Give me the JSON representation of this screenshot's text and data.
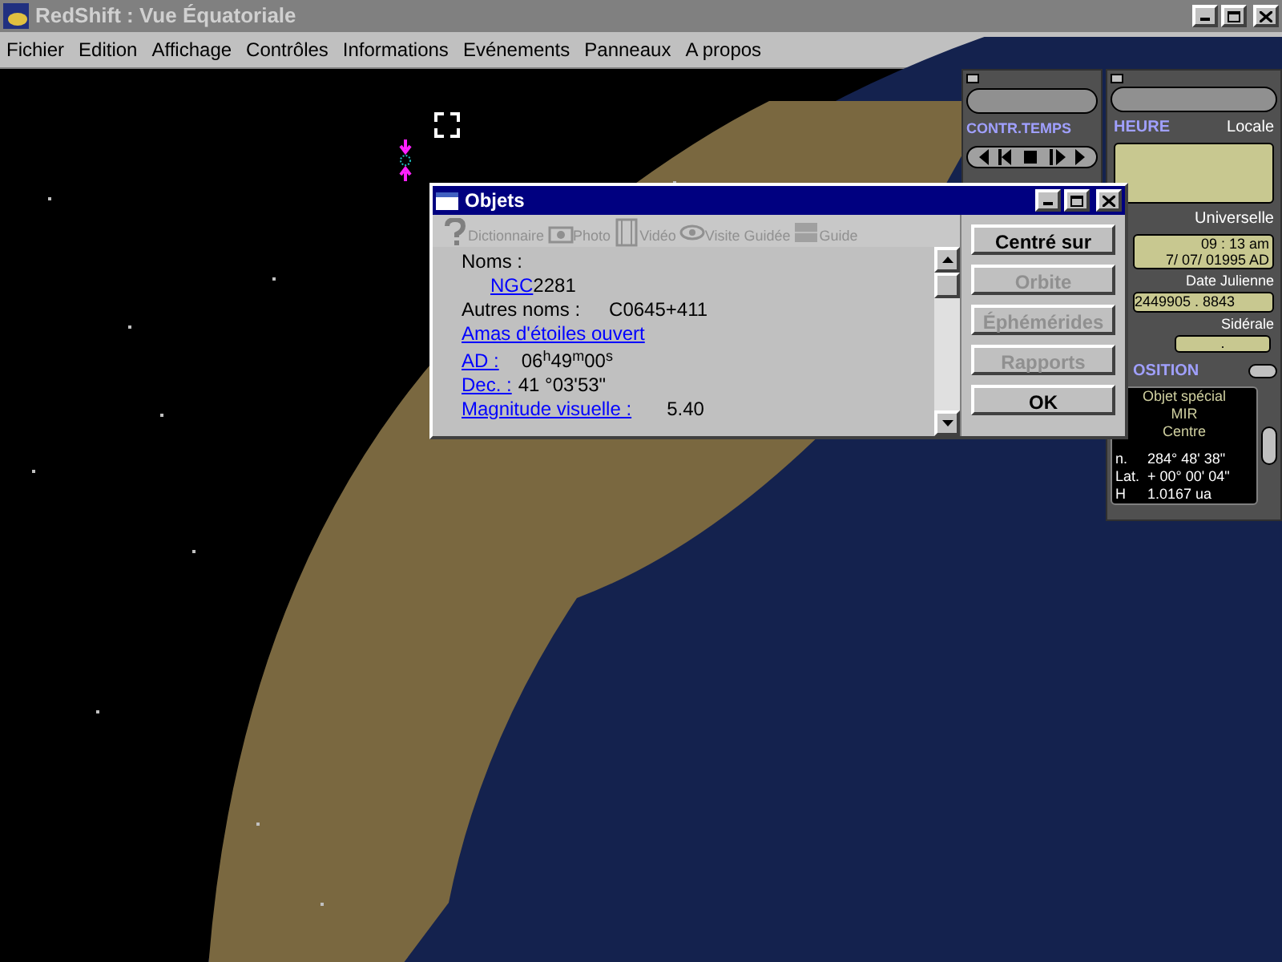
{
  "window": {
    "title": "RedShift : Vue Équatoriale"
  },
  "menu": [
    {
      "label": "Fichier"
    },
    {
      "label": "Edition"
    },
    {
      "label": "Affichage"
    },
    {
      "label": "Contrôles"
    },
    {
      "label": "Informations"
    },
    {
      "label": "Evénements"
    },
    {
      "label": "Panneaux"
    },
    {
      "label": "A propos"
    }
  ],
  "time_control": {
    "title": "CONTR.TEMPS"
  },
  "clock": {
    "title": "HEURE",
    "local_label": "Locale",
    "universal_label": "Universelle",
    "universal_lines": [
      "09 : 13 am",
      "7/ 07/ 01995 AD"
    ],
    "julian_label": "Date Julienne",
    "julian_value": "2449905 . 8843",
    "sidereal_label": "Sidérale",
    "sidereal_value": "."
  },
  "position": {
    "title": "OSITION",
    "lines": [
      "Objet spécial",
      "MIR",
      "Centre"
    ],
    "coords": [
      {
        "label": "n.",
        "value": "284° 48' 38\""
      },
      {
        "label": "Lat.",
        "value": "+ 00° 00' 04\""
      },
      {
        "label": "H",
        "value": "1.0167  ua"
      }
    ]
  },
  "dialog": {
    "title": "Objets",
    "toolbar": [
      {
        "kind": "help",
        "label": "Dictionnaire",
        "disabled": true
      },
      {
        "kind": "camera",
        "label": "Photo",
        "disabled": true
      },
      {
        "kind": "film",
        "label": "Vidéo",
        "disabled": true
      },
      {
        "kind": "eye",
        "label": "Visite Guidée",
        "disabled": true
      },
      {
        "kind": "guide",
        "label": "Guide",
        "disabled": true
      }
    ],
    "info": {
      "names_label": "Noms :",
      "catalog_link": "NGC",
      "catalog_number": "2281",
      "other_names_label": "Autres noms :",
      "other_names": "C0645+411",
      "type_link": "Amas d'étoiles ouvert",
      "ra_link": "AD :",
      "ra_value": "06$^{h}$49$^{m}$00$^{s}$",
      "dec_link": "Dec. :",
      "dec_value": "41 °03'53\"",
      "mag_link": "Magnitude visuelle :",
      "mag_value": "5.40"
    },
    "buttons": [
      {
        "label": "Centré sur",
        "disabled": false
      },
      {
        "label": "Orbite",
        "disabled": true
      },
      {
        "label": "Éphémérides",
        "disabled": true
      },
      {
        "label": "Rapports",
        "disabled": true
      },
      {
        "label": "OK",
        "disabled": false
      }
    ]
  }
}
